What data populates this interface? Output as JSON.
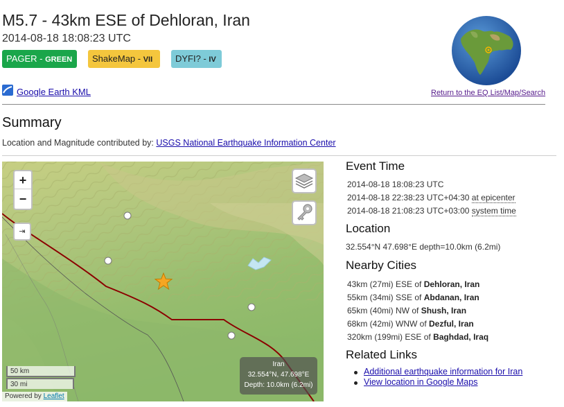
{
  "event": {
    "title": "M5.7 - 43km ESE of Dehloran, Iran",
    "time_utc": "2014-08-18 18:08:23 UTC"
  },
  "badges": {
    "pager_label": "PAGER - ",
    "pager_value": "GREEN",
    "shakemap_label": "ShakeMap - ",
    "shakemap_value": "VII",
    "dyfi_label": "DYFI? - ",
    "dyfi_value": "IV"
  },
  "links": {
    "kml": "Google Earth KML",
    "return": "Return to the EQ List/Map/Search"
  },
  "summary": {
    "heading": "Summary",
    "contributed_prefix": "Location and Magnitude contributed by: ",
    "contributor": "USGS National Earthquake Information Center"
  },
  "map": {
    "zoom_in": "+",
    "zoom_out": "−",
    "nav": "⇥",
    "scale_km": "50 km",
    "scale_mi": "30 mi",
    "powered_prefix": "Powered by ",
    "powered_link": "Leaflet",
    "popup_country": "Iran",
    "popup_coords": "32.554°N, 47.698°E",
    "popup_depth": "Depth: 10.0km (6.2mi)"
  },
  "event_time": {
    "heading": "Event Time",
    "utc": "2014-08-18 18:08:23 UTC",
    "epicenter_time": "2014-08-18 22:38:23 UTC+04:30 ",
    "epicenter_label": "at epicenter",
    "system_time": "2014-08-18 21:08:23 UTC+03:00 ",
    "system_label": "system time"
  },
  "location": {
    "heading": "Location",
    "value": "32.554°N 47.698°E depth=10.0km (6.2mi)"
  },
  "nearby": {
    "heading": "Nearby Cities",
    "cities": [
      {
        "dist": "43km (27mi) ESE of ",
        "name": "Dehloran, Iran"
      },
      {
        "dist": "55km (34mi) SSE of ",
        "name": "Abdanan, Iran"
      },
      {
        "dist": "65km (40mi) NW of ",
        "name": "Shush, Iran"
      },
      {
        "dist": "68km (42mi) WNW of ",
        "name": "Dezful, Iran"
      },
      {
        "dist": "320km (199mi) ESE of ",
        "name": "Baghdad, Iraq"
      }
    ]
  },
  "related": {
    "heading": "Related Links",
    "items": [
      "Additional earthquake information for Iran",
      "View location in Google Maps"
    ]
  },
  "colors": {
    "pager": "#1aa64a",
    "shakemap": "#f4c63d",
    "dyfi": "#7ecbd8",
    "border_line": "#8b0000",
    "epicenter_star": "#f5a623"
  }
}
